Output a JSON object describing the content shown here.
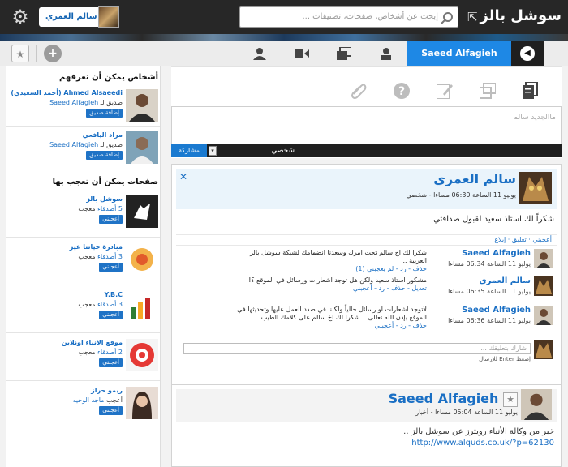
{
  "topbar": {
    "logo": "سوشل بالز",
    "search_placeholder": "إبحث عن أشخاص، صفحات، تصنيفات ...",
    "user_name": "سالم العمري"
  },
  "toolbar": {
    "active_name": "Saeed Alfagieh"
  },
  "sidebar": {
    "people_heading": "أشخاص يمكن أن تعرفهم",
    "people": [
      {
        "name": "Ahmed Alsaeedi (أحمد السعيدي)",
        "friend_of": "صديق لـ",
        "friend_name": "Saeed Alfagieh",
        "action": "إضافة صديق"
      },
      {
        "name": "مراد اليافعي",
        "friend_of": "صديق لـ",
        "friend_name": "Saeed Alfagieh",
        "action": "إضافة صديق"
      }
    ],
    "pages_heading": "صفحات يمكن أن تعجب بها",
    "pages": [
      {
        "name": "سوشل بالز",
        "count": "5 أصدقاء",
        "suffix": "معجب",
        "action": "أعجبني"
      },
      {
        "name": "مبادرة حياتنا غير",
        "count": "3 أصدقاء",
        "suffix": "معجب",
        "action": "أعجبني"
      },
      {
        "name": "Y.B.C",
        "count": "3 أصدقاء",
        "suffix": "معجب",
        "action": "أعجبني"
      },
      {
        "name": "موقع الانباء اونلاين",
        "count": "2 أصدقاء",
        "suffix": "معجب",
        "action": "أعجبني"
      },
      {
        "name": "ريمو حراز",
        "count": "ماجد الوجيه",
        "suffix": "أعجب",
        "action": "أعجبني"
      }
    ]
  },
  "composer": {
    "placeholder": "ماالجديد سالم",
    "privacy": "شخصي",
    "share_label": "مشاركة"
  },
  "post1": {
    "author": "سالم العمري",
    "meta": "يوليو 11 الساعة 06:30 مساءا - شخصي",
    "body": "شكراً لك استاذ سعيد لقبول صداقتي",
    "actions": "أعجبني · تعليق · إبلاغ",
    "comments": [
      {
        "name": "Saeed Alfagieh",
        "time": "يوليو 11 الساعة 06:34 مساءا",
        "text": "شكرا لك اخ سالم تحت امرك وسعدنا انضمامك لشبكة سوشل بالز العربية ..",
        "links": "حذف - رد - لم يعجبني (1)"
      },
      {
        "name": "سالم العمري",
        "time": "يوليو 11 الساعة 06:35 مساءا",
        "text": "مشكور استاذ سعيد ولكن هل توجد اشعارات ورسائل في الموقع ؟!",
        "links": "تعديل - حذف - رد - أعجبني"
      },
      {
        "name": "Saeed Alfagieh",
        "time": "يوليو 11 الساعة 06:36 مساءا",
        "text": "لاتوجد اشعارات او رسائل حالياً ولكننا في صدد العمل عليها وتحديثها في الموقع بإذن الله تعالى .. شكرا لك اخ سالم على كلامك الطيب ..",
        "links": "حذف - رد - أعجبني"
      }
    ],
    "reply_placeholder": "شارك بتعليقك ...",
    "reply_hint": "إضغط Enter للإرسال"
  },
  "post2": {
    "author": "Saeed Alfagieh",
    "meta": "يوليو 11 الساعة 05:04 مساءا - أخبار",
    "body": "خبر من وكالة الأنباء رويترز عن سوشل بالز ..",
    "link": "http://www.alquds.co.uk/?p=62130"
  }
}
